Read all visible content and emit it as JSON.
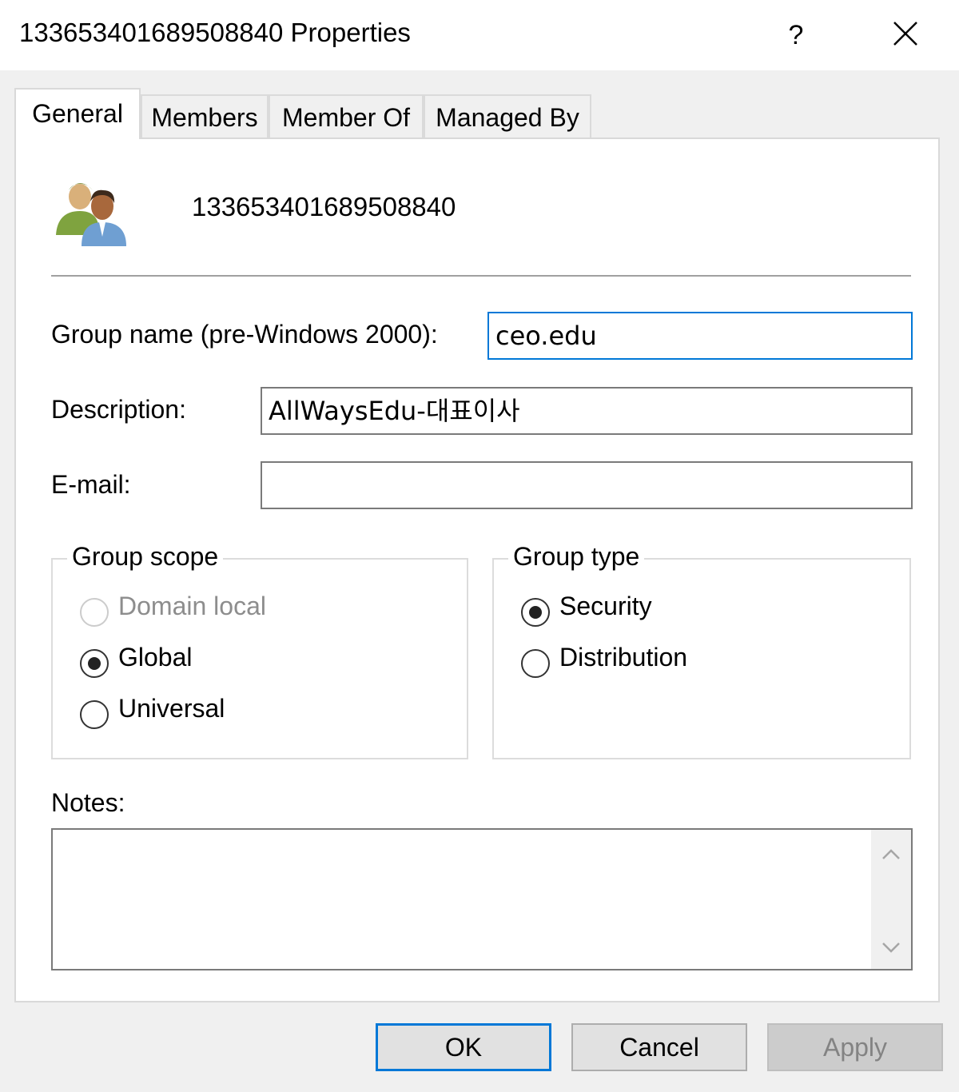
{
  "window": {
    "title": "133653401689508840 Properties",
    "help_label": "?"
  },
  "tabs": [
    {
      "label": "General",
      "active": true
    },
    {
      "label": "Members"
    },
    {
      "label": "Member Of"
    },
    {
      "label": "Managed By"
    }
  ],
  "header": {
    "icon": "group-users-icon",
    "name": "133653401689508840"
  },
  "fields": {
    "group_name_label": "Group name (pre-Windows 2000):",
    "group_name_value": "ceo.edu",
    "description_label": "Description:",
    "description_value": "AllWaysEdu-대표이사",
    "email_label": "E-mail:",
    "email_value": ""
  },
  "group_scope": {
    "title": "Group scope",
    "options": [
      {
        "label": "Domain local",
        "checked": false,
        "disabled": true
      },
      {
        "label": "Global",
        "checked": true,
        "disabled": false
      },
      {
        "label": "Universal",
        "checked": false,
        "disabled": false
      }
    ]
  },
  "group_type": {
    "title": "Group type",
    "options": [
      {
        "label": "Security",
        "checked": true
      },
      {
        "label": "Distribution",
        "checked": false
      }
    ]
  },
  "notes": {
    "label": "Notes:",
    "value": ""
  },
  "buttons": {
    "ok": "OK",
    "cancel": "Cancel",
    "apply": "Apply"
  },
  "colors": {
    "accent": "#0078d7",
    "dialog_bg": "#f0f0f0",
    "panel_bg": "#ffffff"
  }
}
